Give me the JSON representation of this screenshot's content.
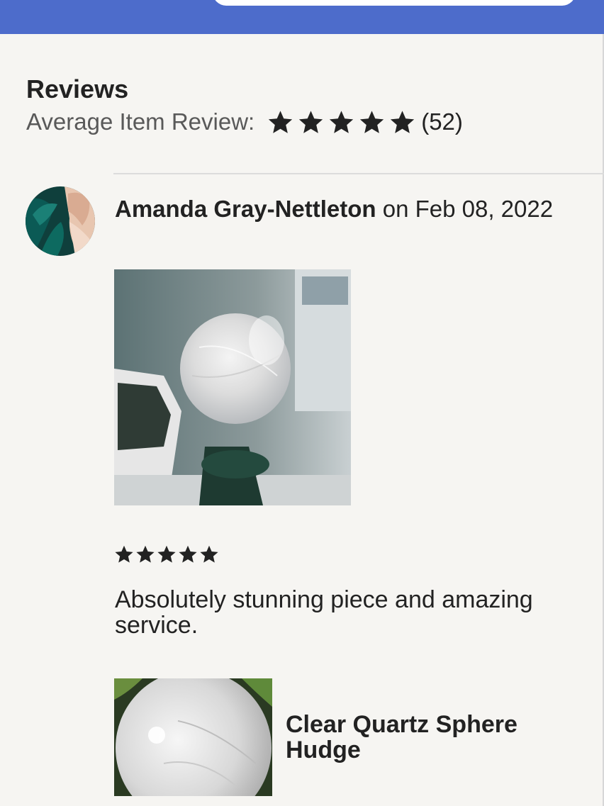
{
  "reviews": {
    "title": "Reviews",
    "average_label": "Average Item Review:",
    "average_rating": 5,
    "review_count": "(52)"
  },
  "review": {
    "reviewer_name": "Amanda Gray-Nettleton",
    "date_text": "on Feb 08, 2022",
    "rating": 5,
    "text": "Absolutely stunning piece and amazing service."
  },
  "product": {
    "title": "Clear Quartz Sphere Hudge"
  },
  "colors": {
    "top_bar": "#4d6ccb",
    "background": "#f6f5f2",
    "star": "#222222"
  },
  "icons": {
    "star": "star-icon"
  }
}
